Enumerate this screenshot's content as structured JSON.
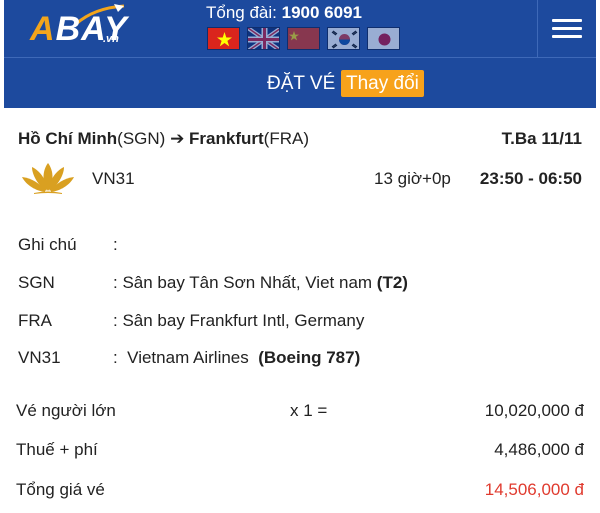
{
  "header": {
    "logo_text": "ABAY",
    "logo_suffix": ".vn",
    "hotline_label": "Tổng đài:",
    "hotline_number": "1900 6091",
    "flags": [
      "vietnam-flag-icon",
      "uk-flag-icon",
      "china-flag-icon",
      "korea-flag-icon",
      "japan-flag-icon"
    ],
    "menu_icon": "hamburger-menu-icon"
  },
  "booking_bar": {
    "title": "ĐẶT VÉ",
    "change_button": "Thay đổi"
  },
  "flight": {
    "origin_city": "Hồ Chí Minh",
    "origin_code": "(SGN)",
    "arrow": "➔",
    "dest_city": "Frankfurt",
    "dest_code": "(FRA)",
    "date": "T.Ba 11/11",
    "airline_icon": "vietnam-airlines-lotus-icon",
    "flight_number": "VN31",
    "duration": "13 giờ+0p",
    "times": "23:50 - 06:50"
  },
  "details": {
    "note_label": "Ghi chú",
    "note_sep": ":",
    "origin_label": "SGN",
    "origin_value": ": Sân bay Tân Sơn Nhất, Viet nam",
    "origin_terminal": "(T2)",
    "dest_label": "FRA",
    "dest_value": ": Sân bay Frankfurt Intl, Germany",
    "flight_label": "VN31",
    "flight_value": ":  Vietnam Airlines ",
    "aircraft": "(Boeing 787)"
  },
  "prices": {
    "adult_label": "Vé người lớn",
    "adult_qty": "x 1 =",
    "adult_amount": "10,020,000 đ",
    "tax_label": "Thuế + phí",
    "tax_amount": "4,486,000 đ",
    "total_label": "Tổng giá vé",
    "total_amount": "14,506,000 đ"
  },
  "colors": {
    "brand_blue": "#1d4a9e",
    "accent_orange": "#f7a21b",
    "total_red": "#e03a2e",
    "lotus_gold": "#d9a021"
  }
}
